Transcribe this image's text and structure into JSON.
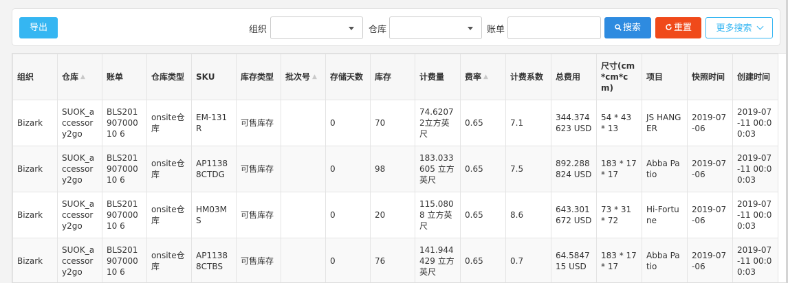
{
  "toolbar": {
    "export_label": "导出",
    "org_label": "组织",
    "org_value": "",
    "warehouse_label": "仓库",
    "warehouse_value": "",
    "bill_label": "账单",
    "bill_value": "",
    "search_label": "搜索",
    "reset_label": "重置",
    "more_search_label": "更多搜索"
  },
  "colors": {
    "export": "#35b6f2",
    "search": "#2e8be0",
    "reset": "#f04a1a",
    "more": "#35b6f2"
  },
  "icons": {
    "search": "search-icon",
    "reset": "reset-icon",
    "more": "chevron-down-icon",
    "sort": "sort-icon"
  },
  "table": {
    "columns": [
      {
        "label": "组织",
        "sortable": false
      },
      {
        "label": "仓库",
        "sortable": true
      },
      {
        "label": "账单",
        "sortable": false
      },
      {
        "label": "仓库类型",
        "sortable": false
      },
      {
        "label": "SKU",
        "sortable": false
      },
      {
        "label": "库存类型",
        "sortable": false
      },
      {
        "label": "批次号",
        "sortable": true
      },
      {
        "label": "存储天数",
        "sortable": false
      },
      {
        "label": "库存",
        "sortable": false
      },
      {
        "label": "计费量",
        "sortable": false
      },
      {
        "label": "费率",
        "sortable": true
      },
      {
        "label": "计费系数",
        "sortable": false
      },
      {
        "label": "总费用",
        "sortable": false
      },
      {
        "label": "尺寸(cm*cm*cm)",
        "sortable": false
      },
      {
        "label": "项目",
        "sortable": false
      },
      {
        "label": "快照时间",
        "sortable": false
      },
      {
        "label": "创建时间",
        "sortable": false
      }
    ],
    "rows": [
      [
        "Bizark",
        "SUOK_accessory2go",
        "BLS20190700010 6",
        "onsite仓库",
        "EM-131R",
        "可售库存",
        "",
        "0",
        "70",
        "74.62072立方英尺",
        "0.65",
        "7.1",
        "344.374623 USD",
        "54 * 43 * 13",
        "JS HANGER",
        "2019-07-06",
        "2019-07-11 00:00:03"
      ],
      [
        "Bizark",
        "SUOK_accessory2go",
        "BLS20190700010 6",
        "onsite仓库",
        "AP11388CTDG",
        "可售库存",
        "",
        "0",
        "98",
        "183.033605 立方英尺",
        "0.65",
        "7.5",
        "892.288824 USD",
        "183 * 17 * 17",
        "Abba Patio",
        "2019-07-06",
        "2019-07-11 00:00:03"
      ],
      [
        "Bizark",
        "SUOK_accessory2go",
        "BLS20190700010 6",
        "onsite仓库",
        "HM03MS",
        "可售库存",
        "",
        "0",
        "20",
        "115.0808 立方英尺",
        "0.65",
        "8.6",
        "643.301672 USD",
        "73 * 31 * 72",
        "Hi-Fortune",
        "2019-07-06",
        "2019-07-11 00:00:03"
      ],
      [
        "Bizark",
        "SUOK_accessory2go",
        "BLS20190700010 6",
        "onsite仓库",
        "AP11388CTBS",
        "可售库存",
        "",
        "0",
        "76",
        "141.944429 立方英尺",
        "0.65",
        "0.7",
        "64.584715 USD",
        "183 * 17 * 17",
        "Abba Patio",
        "2019-07-06",
        "2019-07-11 00:00:03"
      ]
    ]
  }
}
